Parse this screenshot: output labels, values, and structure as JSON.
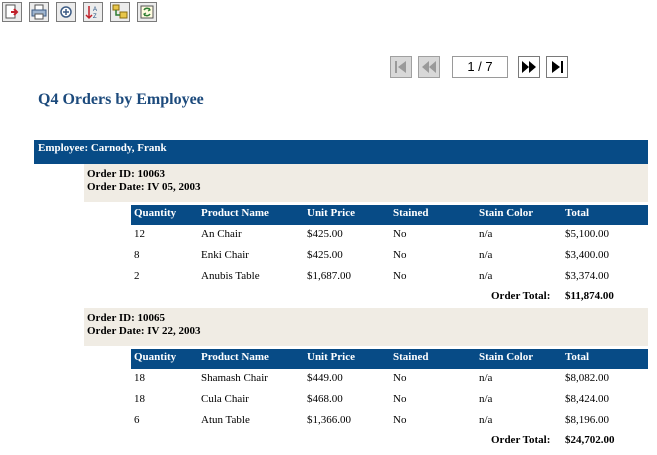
{
  "toolbar": {
    "items": [
      {
        "name": "export-icon"
      },
      {
        "name": "print-icon"
      },
      {
        "name": "zoom-icon"
      },
      {
        "name": "sort-icon"
      },
      {
        "name": "group-tree-icon"
      },
      {
        "name": "refresh-icon"
      }
    ]
  },
  "pager": {
    "page_display": "1 / 7",
    "current_page": 1,
    "total_pages": 7
  },
  "report": {
    "title": "Q4 Orders by Employee",
    "employee_label": "Employee: Carnody, Frank",
    "columns": [
      "Quantity",
      "Product Name",
      "Unit Price",
      "Stained",
      "Stain Color",
      "Total"
    ],
    "orders": [
      {
        "order_id": "Order ID: 10063",
        "order_date": "Order Date: IV 05, 2003",
        "rows": [
          [
            "12",
            "An Chair",
            "$425.00",
            "No",
            "n/a",
            "$5,100.00"
          ],
          [
            "8",
            "Enki Chair",
            "$425.00",
            "No",
            "n/a",
            "$3,400.00"
          ],
          [
            "2",
            "Anubis Table",
            "$1,687.00",
            "No",
            "n/a",
            "$3,374.00"
          ]
        ],
        "total_label": "Order Total:",
        "total_value": "$11,874.00"
      },
      {
        "order_id": "Order ID: 10065",
        "order_date": "Order Date: IV 22, 2003",
        "rows": [
          [
            "18",
            "Shamash Chair",
            "$449.00",
            "No",
            "n/a",
            "$8,082.00"
          ],
          [
            "18",
            "Cula Chair",
            "$468.00",
            "No",
            "n/a",
            "$8,424.00"
          ],
          [
            "6",
            "Atun Table",
            "$1,366.00",
            "No",
            "n/a",
            "$8,196.00"
          ]
        ],
        "total_label": "Order Total:",
        "total_value": "$24,702.00"
      }
    ]
  }
}
